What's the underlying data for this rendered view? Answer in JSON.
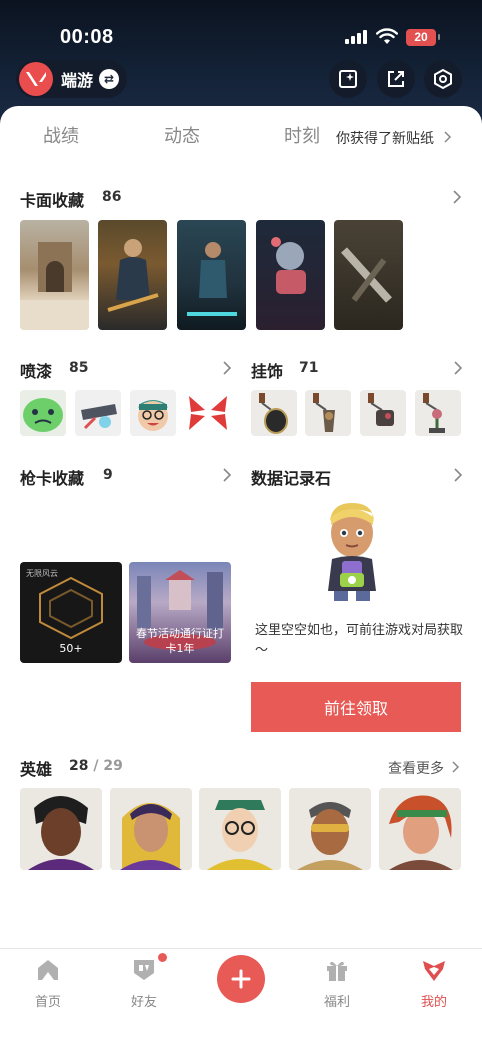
{
  "status": {
    "time": "00:08",
    "battery": "20"
  },
  "header": {
    "app_name": "端游",
    "logo_icon": "valorant-logo-icon"
  },
  "tabs": [
    {
      "label": "战绩"
    },
    {
      "label": "动态"
    },
    {
      "label": "时刻"
    }
  ],
  "notice": "你获得了新贴纸",
  "card_collection": {
    "title": "卡面收藏",
    "count": "86"
  },
  "sprays": {
    "title": "喷漆",
    "count": "85"
  },
  "charms": {
    "title": "挂饰",
    "count": "71"
  },
  "gun_cards": {
    "title": "枪卡收藏",
    "count": "9",
    "items": [
      {
        "top_label": "无限风云",
        "bottom_label": "50+"
      },
      {
        "label": "春节活动通行证打卡1年"
      }
    ]
  },
  "data_stone": {
    "title": "数据记录石",
    "empty_text": "这里空空如也，可前往游戏对局获取～",
    "claim_label": "前往领取"
  },
  "heroes": {
    "title": "英雄",
    "owned": "28",
    "separator": "/",
    "total": "29",
    "more_label": "查看更多"
  },
  "nav": [
    {
      "label": "首页",
      "icon": "home-icon"
    },
    {
      "label": "好友",
      "icon": "friends-icon"
    },
    {
      "label": "福利",
      "icon": "gift-icon"
    },
    {
      "label": "我的",
      "icon": "profile-icon"
    }
  ],
  "colors": {
    "accent": "#e85a55",
    "dark_header": "#0f1a2c"
  }
}
